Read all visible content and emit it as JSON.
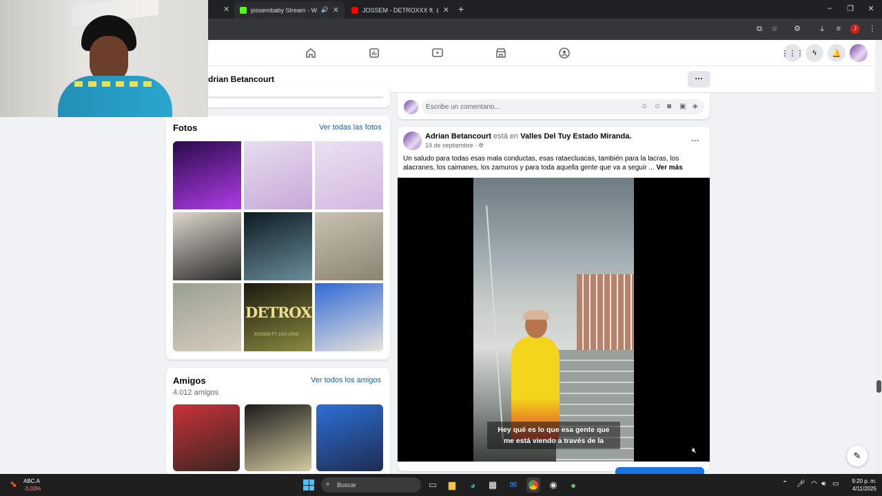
{
  "browser": {
    "tabs": [
      {
        "label": "jossembaby Stream - Watch",
        "favicon_color": "#53fc18",
        "audio_icon": "speaker-icon"
      },
      {
        "label": "JOSSEM - DETROXXX ft. @Loul",
        "favicon_color": "#ff0000"
      }
    ],
    "new_tab": "+",
    "profile_initial": "J"
  },
  "facebook": {
    "profile_name": "drian Betancourt",
    "more_button": "···",
    "comment_placeholder": "Escribe un comentario...",
    "photos": {
      "title": "Fotos",
      "see_all": "Ver todas las fotos",
      "thumb_text": "DETROXX",
      "thumb_sub": "JOSSEM FT. LOU LENZ",
      "tiles": [
        {
          "c1": "#2a0a4a",
          "c2": "#b03ce8"
        },
        {
          "c1": "#e8dcee",
          "c2": "#c6a9d8"
        },
        {
          "c1": "#ece0f2",
          "c2": "#d2b8e0"
        },
        {
          "c1": "#ddd7cc",
          "c2": "#2b2b2b"
        },
        {
          "c1": "#0d1a22",
          "c2": "#6a8e9a"
        },
        {
          "c1": "#c9c2b3",
          "c2": "#8a8470"
        },
        {
          "c1": "#9aa091",
          "c2": "#d6cdbf"
        },
        {
          "c1": "#1b1a10",
          "c2": "#8c8a40"
        },
        {
          "c1": "#2f6ad6",
          "c2": "#e9e3dc"
        }
      ]
    },
    "friends": {
      "title": "Amigos",
      "count": "4.012 amigos",
      "see_all": "Ver todos los amigos",
      "tiles": [
        {
          "c1": "#c8323a",
          "c2": "#3a2520"
        },
        {
          "c1": "#1a1a1a",
          "c2": "#d4c9a0"
        },
        {
          "c1": "#2d6fd6",
          "c2": "#1f2c52"
        }
      ]
    },
    "post": {
      "author": "Adrian Betancourt",
      "is_at": "está en",
      "place": "Valles Del Tuy Estado Miranda.",
      "date": "19 de septiembre ·",
      "menu": "···",
      "text": "Un saludo para todas esas mala conductas, esas rataecluacas, también para la lacras, los alacranes, los caimanes, los zamuros y para toda aquella gente que va a seguir ...",
      "see_more": "Ver más",
      "subtitle_line1": "Hey qué es lo que esa gente que",
      "subtitle_line2": "me está viendo a través de la"
    },
    "compose_icon": "compose-icon"
  },
  "taskbar": {
    "stock_name": "ABC.A",
    "stock_change": "-3,03%",
    "search_placeholder": "Buscar",
    "time": "9:20 p. m.",
    "date": "4/11/2025"
  }
}
